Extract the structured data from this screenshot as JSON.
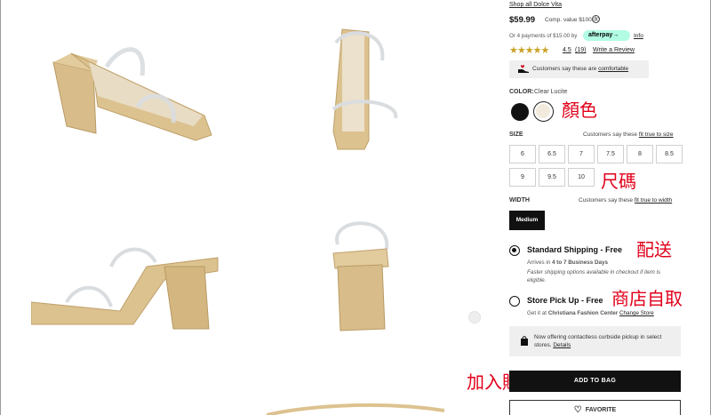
{
  "product": {
    "shop_link": "Shop all Dolce Vita",
    "price": "$59.99",
    "comp_value": "Comp. value $100.00",
    "info_icon": "i",
    "afterpay_text": "Or 4 payments of $15.00 by",
    "afterpay_brand": "afterpay→",
    "afterpay_info": "Info",
    "stars": "★★★★★",
    "rating_value": 4.5,
    "rating": "4.5",
    "reviews": "(19)",
    "write_review": "Write a Review",
    "comfort_text": "Customers say these are",
    "comfort_link": "comfortable"
  },
  "color": {
    "label": "COLOR:",
    "value": "Clear Lucite",
    "swatches": [
      {
        "name": "black",
        "hex": "#111111"
      },
      {
        "name": "clear lucite",
        "hex": "#f1eadd",
        "selected": true
      }
    ]
  },
  "size": {
    "label": "SIZE",
    "fit_text": "Customers say these",
    "fit_link": "fit true to size",
    "options": [
      "6",
      "6.5",
      "7",
      "7.5",
      "8",
      "8.5",
      "9",
      "9.5",
      "10"
    ]
  },
  "width": {
    "label": "WIDTH",
    "fit_text": "Customers say these",
    "fit_link": "fit true to width",
    "selected": "Medium"
  },
  "shipping": {
    "standard_title": "Standard Shipping - Free",
    "standard_arrives_prefix": "Arrives in",
    "standard_arrives_bold": "4 to 7 Business Days",
    "standard_note": "Faster shipping options available in checkout if item is eligible.",
    "pickup_title": "Store Pick Up - Free",
    "pickup_prefix": "Get it at",
    "pickup_store": "Christiana Fashion Center",
    "pickup_change": "Change Store",
    "selected": "standard"
  },
  "curbside": {
    "text": "Now offering contactless curbside pickup in select stores.",
    "link": "Details"
  },
  "buttons": {
    "add_to_bag": "ADD TO BAG",
    "favorite": "FAVORITE"
  },
  "annotations": {
    "color": "顏色",
    "size": "尺碼",
    "shipping": "配送",
    "pickup": "商店自取",
    "cart": "加入購物車"
  },
  "colors": {
    "accent": "#111111",
    "annotation": "#e0001a",
    "afterpay": "#b2fce4",
    "star": "#c9a227"
  }
}
